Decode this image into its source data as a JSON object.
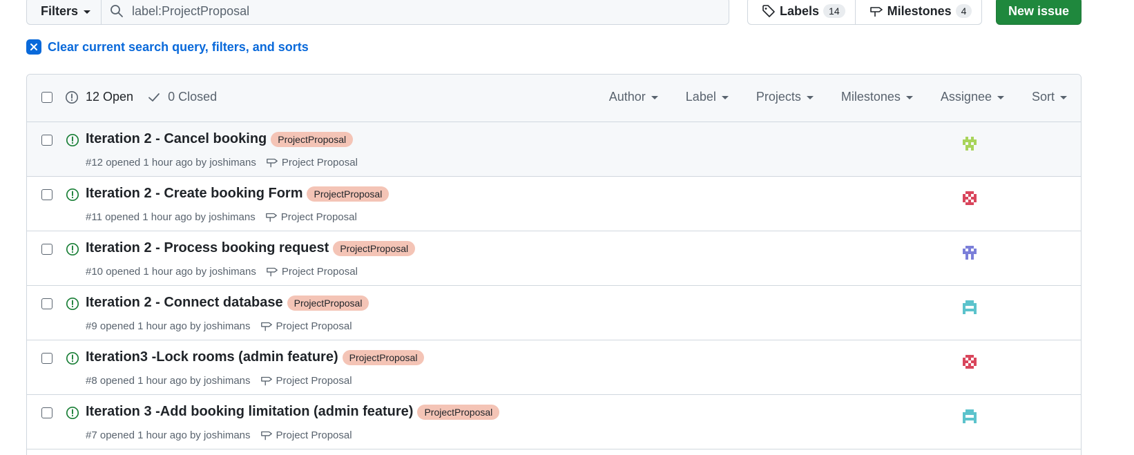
{
  "toolbar": {
    "filters_label": "Filters",
    "search_value": "label:ProjectProposal",
    "labels_label": "Labels",
    "labels_count": "14",
    "milestones_label": "Milestones",
    "milestones_count": "4",
    "new_issue_label": "New issue",
    "accent": "#1f883d"
  },
  "clear_filter": {
    "text": "Clear current search query, filters, and sorts"
  },
  "header": {
    "open_label": "12 Open",
    "closed_label": "0 Closed",
    "filters": [
      "Author",
      "Label",
      "Projects",
      "Milestones",
      "Assignee",
      "Sort"
    ]
  },
  "issues": [
    {
      "title": "Iteration 2 - Cancel booking",
      "label": "ProjectProposal",
      "meta": "#12 opened 1 hour ago by joshimans",
      "milestone": "Project Proposal",
      "avatar_color": "#a8d45a"
    },
    {
      "title": "Iteration 2 - Create booking Form",
      "label": "ProjectProposal",
      "meta": "#11 opened 1 hour ago by joshimans",
      "milestone": "Project Proposal",
      "avatar_color": "#d9465c"
    },
    {
      "title": "Iteration 2 - Process booking request",
      "label": "ProjectProposal",
      "meta": "#10 opened 1 hour ago by joshimans",
      "milestone": "Project Proposal",
      "avatar_color": "#7b7fd9"
    },
    {
      "title": "Iteration 2 - Connect database",
      "label": "ProjectProposal",
      "meta": "#9 opened 1 hour ago by joshimans",
      "milestone": "Project Proposal",
      "avatar_color": "#5cc3cc"
    },
    {
      "title": "Iteration3 -Lock rooms (admin feature)",
      "label": "ProjectProposal",
      "meta": "#8 opened 1 hour ago by joshimans",
      "milestone": "Project Proposal",
      "avatar_color": "#d9465c"
    },
    {
      "title": "Iteration 3 -Add booking limitation (admin feature)",
      "label": "ProjectProposal",
      "meta": "#7 opened 1 hour ago by joshimans",
      "milestone": "Project Proposal",
      "avatar_color": "#5cc3cc"
    }
  ]
}
